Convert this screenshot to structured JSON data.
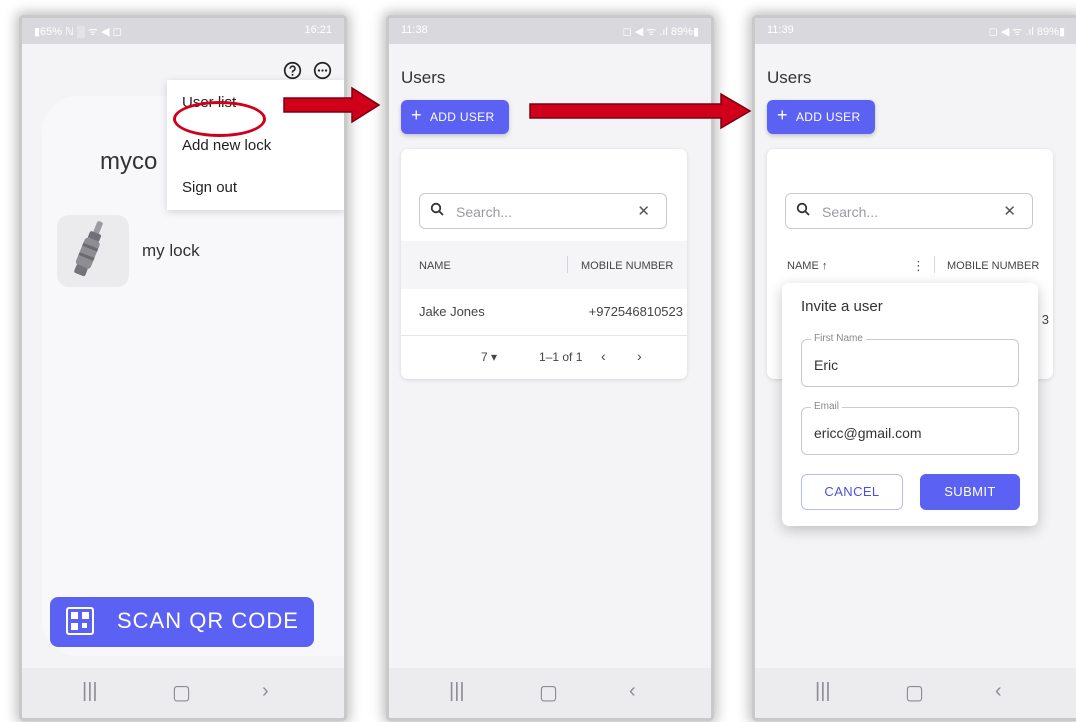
{
  "colors": {
    "accent": "#5b61f2",
    "highlight_red": "#d0001b"
  },
  "phone1": {
    "status_left": "▮65% ℕ ▒ ᯤ ◀ ◻",
    "status_right": "16:21",
    "help_icon": "help-circle-icon",
    "more_icon": "more-horizontal-icon",
    "menu": [
      "User list",
      "Add new lock",
      "Sign out"
    ],
    "app_name": "myco",
    "lock_name": "my lock",
    "scan_label": "SCAN QR CODE",
    "nav": [
      "|||",
      "▢",
      "›"
    ]
  },
  "phone2": {
    "status_left": "11:38",
    "status_right": "◻ ◀ ᯤ .ıl 89%▮",
    "title": "Users",
    "add_label": "ADD USER",
    "search_placeholder": "Search...",
    "columns": [
      "NAME",
      "MOBILE NUMBER"
    ],
    "rows": [
      {
        "name": "Jake Jones",
        "mobile": "+972546810523"
      }
    ],
    "rows_per_page": "7 ▾",
    "range": "1–1 of 1",
    "prev": "‹",
    "next": "›",
    "nav": [
      "|||",
      "▢",
      "‹"
    ]
  },
  "phone3": {
    "status_left": "11:39",
    "status_right": "◻ ◀ ᯤ .ıl 89%▮",
    "title": "Users",
    "add_label": "ADD USER",
    "search_placeholder": "Search...",
    "columns": [
      "NAME ↑",
      "MOBILE NUMBER"
    ],
    "row_peek": "3",
    "dialog": {
      "title": "Invite a user",
      "first_name_label": "First Name",
      "first_name_value": "Eric",
      "email_label": "Email",
      "email_value": "ericc@gmail.com",
      "cancel": "CANCEL",
      "submit": "SUBMIT"
    },
    "nav": [
      "|||",
      "▢",
      "‹"
    ]
  }
}
